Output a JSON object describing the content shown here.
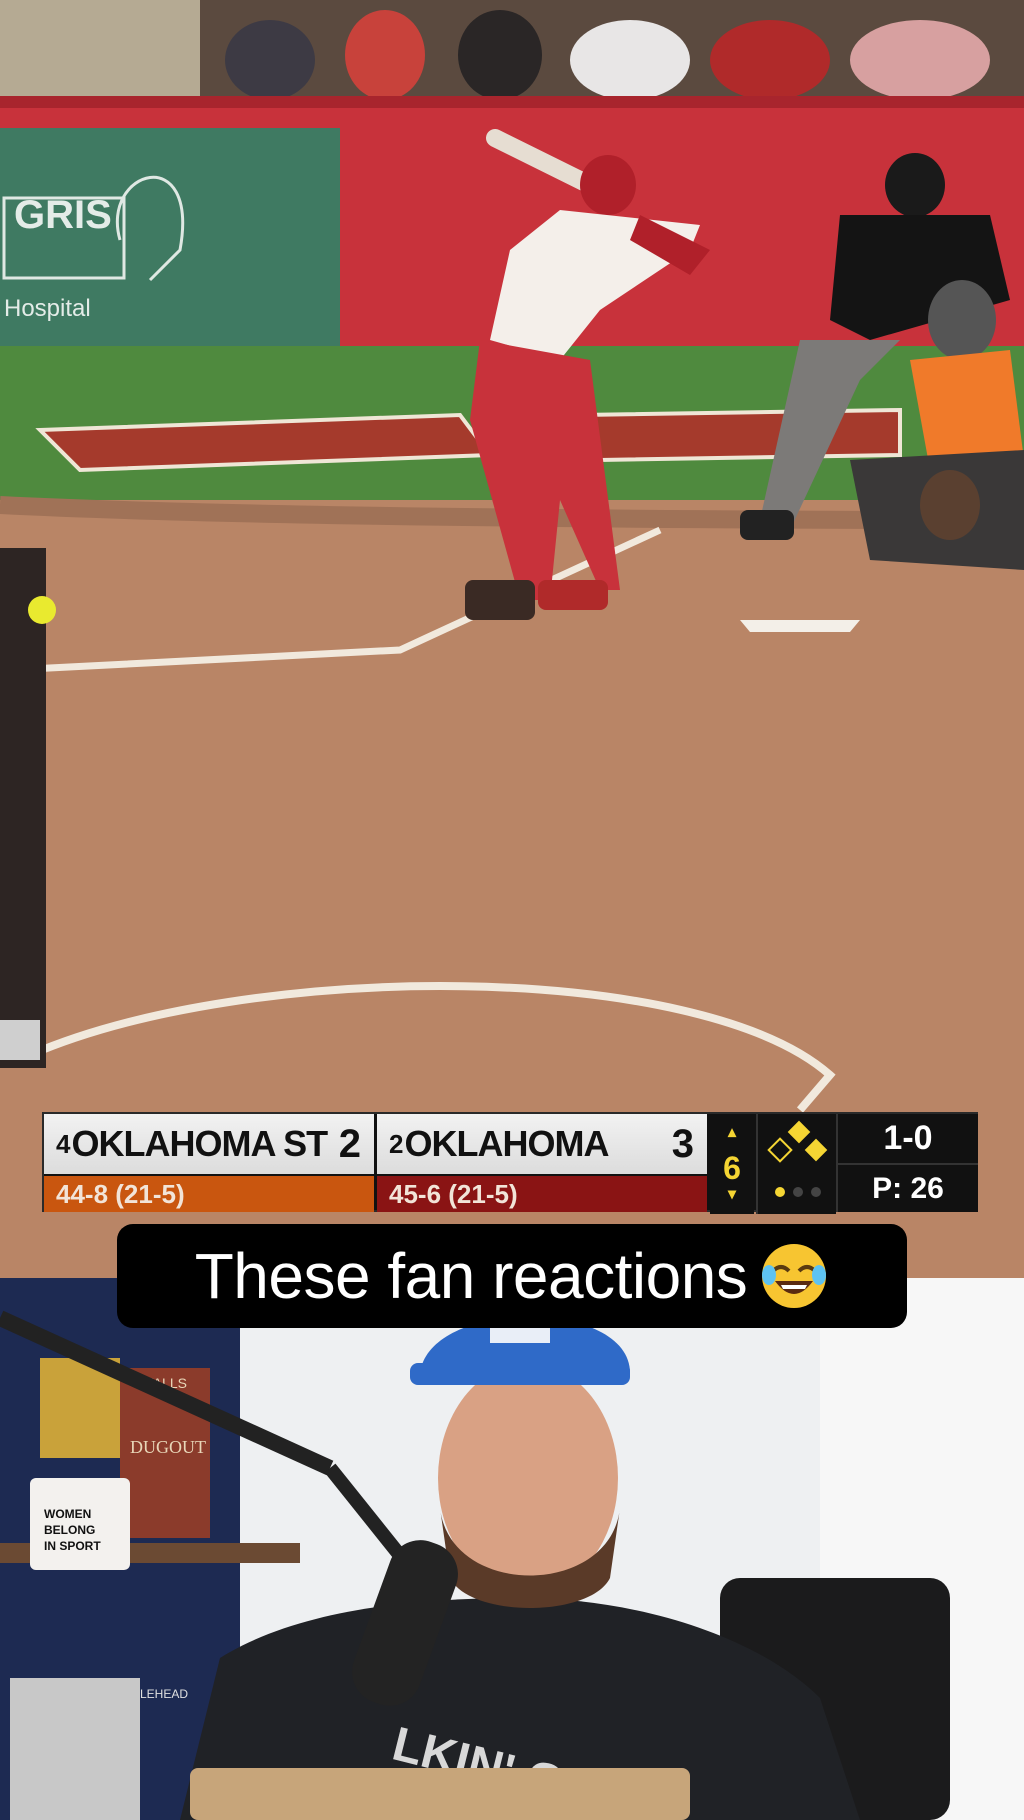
{
  "scoreboard": {
    "away": {
      "rank": "4",
      "name": "OKLAHOMA ST",
      "score": "2",
      "record": "44-8 (21-5)",
      "color": "#c9560f"
    },
    "home": {
      "rank": "2",
      "name": "OKLAHOMA",
      "score": "3",
      "record": "45-6 (21-5)",
      "color": "#8a1414"
    },
    "inning": "6",
    "count": "1-0",
    "pitch_count": "P: 26"
  },
  "caption": {
    "text": "These fan reactions",
    "emoji_icon": "laughing-tears-emoji"
  },
  "scene_text": {
    "sponsor_sign_line1": "GRIS",
    "sponsor_sign_line2": "Hospital",
    "mug_text": [
      "WOMEN",
      "BELONG",
      "IN SPORT"
    ],
    "shirt_text": "LKIN' GIANT",
    "book_text": "DUGOUT",
    "book_top_text": "WALLS",
    "book_bottom_text": "LEHEAD"
  }
}
